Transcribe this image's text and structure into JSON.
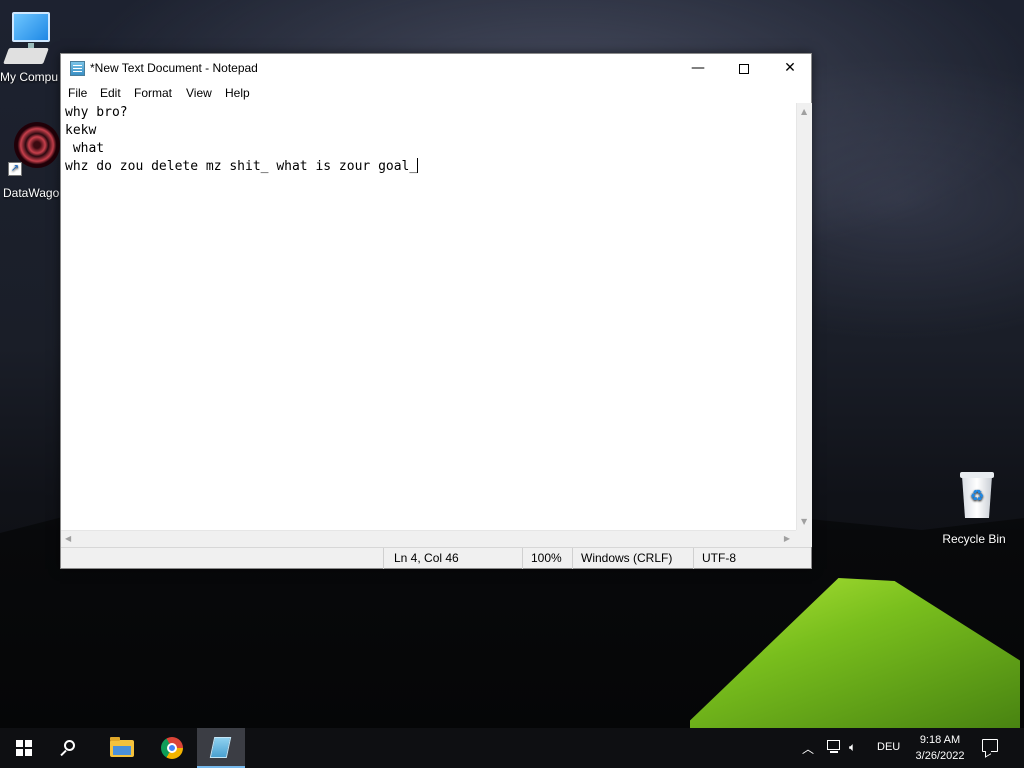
{
  "desktop": {
    "icons": [
      {
        "label": "My Compu",
        "icon": "computer-icon"
      },
      {
        "label": "DataWagon",
        "icon": "datawagon-icon"
      },
      {
        "label": "Recycle Bin",
        "icon": "recycle-bin-icon"
      }
    ]
  },
  "notepad": {
    "title": "*New Text Document - Notepad",
    "window_buttons": {
      "minimize": "—",
      "maximize": "",
      "close": "✕"
    },
    "menu": {
      "file": "File",
      "edit": "Edit",
      "format": "Format",
      "view": "View",
      "help": "Help"
    },
    "content": "why bro?\nkekw\n what\nwhz do zou delete mz shit_ what is zour goal_",
    "status": {
      "position": "Ln 4, Col 46",
      "zoom": "100%",
      "line_endings": "Windows (CRLF)",
      "encoding": "UTF-8"
    }
  },
  "taskbar": {
    "pinned": [
      {
        "name": "File Explorer",
        "icon": "folder-icon"
      },
      {
        "name": "Google Chrome",
        "icon": "chrome-icon"
      },
      {
        "name": "Notepad",
        "icon": "notepad-icon",
        "active": true
      }
    ],
    "tray": {
      "language": "DEU",
      "time": "9:18 AM",
      "date": "3/26/2022"
    }
  },
  "colors": {
    "taskbar": "#0e0f12",
    "active_indicator": "#76b9ed",
    "statusbar": "#f0f0f0"
  }
}
